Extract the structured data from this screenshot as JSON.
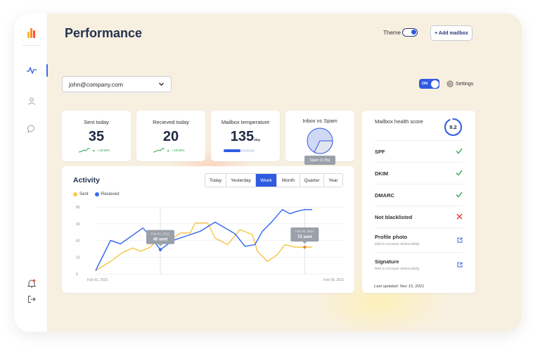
{
  "header": {
    "title": "Performance",
    "theme_label": "Theme",
    "add_mailbox": "+ Add mailbox"
  },
  "sidebar": {
    "logo_colors": [
      "#ff8a2a",
      "#ff4d3a",
      "#ffb52a"
    ],
    "items": [
      {
        "icon": "activity-icon",
        "active": true
      },
      {
        "icon": "user-icon",
        "active": false
      },
      {
        "icon": "chat-icon",
        "active": false
      },
      {
        "icon": "bell-icon",
        "active": false
      },
      {
        "icon": "logout-icon",
        "active": false
      }
    ]
  },
  "mailbox": {
    "email": "john@company.com",
    "toggle_label": "ON",
    "settings_label": "Settings"
  },
  "stats": {
    "sent": {
      "label": "Sent today",
      "value": "35",
      "trend": "+18.50%"
    },
    "received": {
      "label": "Recieved today",
      "value": "20",
      "trend": "+18.50%"
    },
    "temperature": {
      "label": "Mailbox temperature",
      "value": "135",
      "unit": "/day",
      "level": 0.55
    },
    "inbox_spam": {
      "label": "Inbox vs Spam",
      "spam_label": "Spam (2.3%)",
      "spam_percent": 2.3
    }
  },
  "health": {
    "title": "Mailbox health score",
    "score": "9.2",
    "score_fraction": 0.92,
    "checks": [
      {
        "label": "SPF",
        "status": "pass",
        "sub": ""
      },
      {
        "label": "DKIM",
        "status": "pass",
        "sub": ""
      },
      {
        "label": "DMARC",
        "status": "pass",
        "sub": ""
      },
      {
        "label": "Not blacklisted",
        "status": "fail",
        "sub": ""
      },
      {
        "label": "Profile photo",
        "status": "link",
        "sub": "Add to increase deliverability"
      },
      {
        "label": "Signature",
        "status": "link",
        "sub": "Add to increase deliverability"
      }
    ],
    "updated": "Last updated: Nov 15, 2021",
    "colors": {
      "pass": "#2aa54f",
      "fail": "#e53935",
      "link": "#2f5be0"
    }
  },
  "activity": {
    "title": "Activity",
    "tabs": [
      "Today",
      "Yesterday",
      "Week",
      "Month",
      "Quarter",
      "Year"
    ],
    "active_tab": "Week"
  },
  "chart_data": {
    "type": "line",
    "title": "Activity",
    "ylim": [
      0,
      80
    ],
    "yticks": [
      "0",
      "20",
      "40",
      "60",
      "80"
    ],
    "x_start_label": "Feb 01, 2021",
    "x_end_label": "Feb 05, 2021",
    "x": [
      0,
      1,
      2,
      3,
      4,
      5,
      6,
      7,
      8,
      9,
      10,
      11,
      12,
      13,
      14,
      15,
      16,
      17,
      18,
      19,
      20,
      21,
      22,
      23,
      24,
      25,
      26,
      27,
      28,
      29,
      30,
      31,
      32,
      33,
      34,
      35,
      36,
      37,
      38,
      39,
      40,
      41,
      42,
      43,
      44,
      45,
      46,
      47,
      48,
      49,
      50,
      51,
      52,
      53,
      54,
      55,
      56,
      57,
      58,
      59,
      60,
      61,
      62,
      63,
      64,
      65,
      66,
      67,
      68,
      69,
      70,
      71,
      72,
      73,
      74,
      75,
      76,
      77,
      78,
      79,
      80,
      81,
      82,
      83,
      84,
      85,
      86,
      87,
      88,
      89,
      90,
      91,
      92,
      93,
      94,
      95,
      96,
      97,
      98,
      99,
      100
    ],
    "grid": true,
    "legend": "top-left",
    "series": [
      {
        "name": "Sent",
        "color": "#f9c74f",
        "points": [
          [
            0,
            4
          ],
          [
            6,
            15
          ],
          [
            11,
            26
          ],
          [
            15,
            31
          ],
          [
            18,
            27
          ],
          [
            22,
            32
          ],
          [
            26,
            45
          ],
          [
            30,
            40
          ],
          [
            34,
            49
          ],
          [
            38,
            49
          ],
          [
            40,
            61
          ],
          [
            45,
            61
          ],
          [
            48,
            43
          ],
          [
            53,
            35
          ],
          [
            58,
            53
          ],
          [
            63,
            47
          ],
          [
            65,
            27
          ],
          [
            69,
            15
          ],
          [
            73,
            23
          ],
          [
            76,
            35
          ],
          [
            80,
            32
          ],
          [
            84,
            32
          ],
          [
            87,
            32
          ]
        ]
      },
      {
        "name": "Recieved",
        "color": "#3a6cf0",
        "points": [
          [
            0,
            4
          ],
          [
            6,
            40
          ],
          [
            10,
            36
          ],
          [
            19,
            55
          ],
          [
            22,
            45
          ],
          [
            26,
            29
          ],
          [
            31,
            40
          ],
          [
            42,
            51
          ],
          [
            48,
            62
          ],
          [
            56,
            48
          ],
          [
            60,
            33
          ],
          [
            64,
            35
          ],
          [
            67,
            51
          ],
          [
            71,
            63
          ],
          [
            75,
            77
          ],
          [
            78,
            72
          ],
          [
            81,
            75
          ],
          [
            84,
            77
          ],
          [
            87,
            77
          ]
        ]
      }
    ],
    "tooltips": [
      {
        "title": "Feb 02, 2021",
        "value": "40 sent"
      },
      {
        "title": "Feb 04, 2021",
        "value": "72 sent"
      }
    ]
  }
}
